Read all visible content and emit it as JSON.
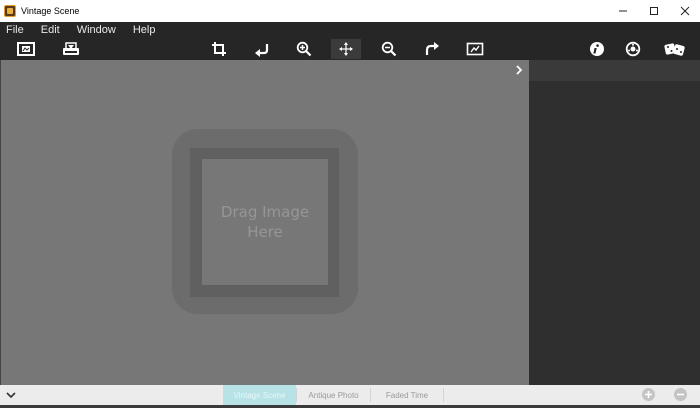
{
  "window": {
    "title": "Vintage Scene"
  },
  "menu": {
    "items": [
      "File",
      "Edit",
      "Window",
      "Help"
    ]
  },
  "toolbar": {
    "tools": [
      {
        "name": "open-image-icon"
      },
      {
        "name": "save-image-icon"
      },
      {
        "name": "crop-icon"
      },
      {
        "name": "rotate-left-icon"
      },
      {
        "name": "zoom-in-icon"
      },
      {
        "name": "move-icon",
        "active": true
      },
      {
        "name": "zoom-out-icon"
      },
      {
        "name": "rotate-right-icon"
      },
      {
        "name": "fit-image-icon"
      },
      {
        "name": "info-icon"
      },
      {
        "name": "settings-icon"
      },
      {
        "name": "random-dice-icon"
      }
    ]
  },
  "canvas": {
    "drop_text_line1": "Drag Image",
    "drop_text_line2": "Here"
  },
  "presets": {
    "tabs": [
      {
        "label": "Vintage Scene",
        "active": true
      },
      {
        "label": "Antique Photo",
        "active": false
      },
      {
        "label": "Faded Time",
        "active": false
      }
    ]
  },
  "colors": {
    "menubar": "#262626",
    "canvas": "#777777",
    "side_panel": "#2f2f2f",
    "active_tab": "#b7e3e6"
  }
}
